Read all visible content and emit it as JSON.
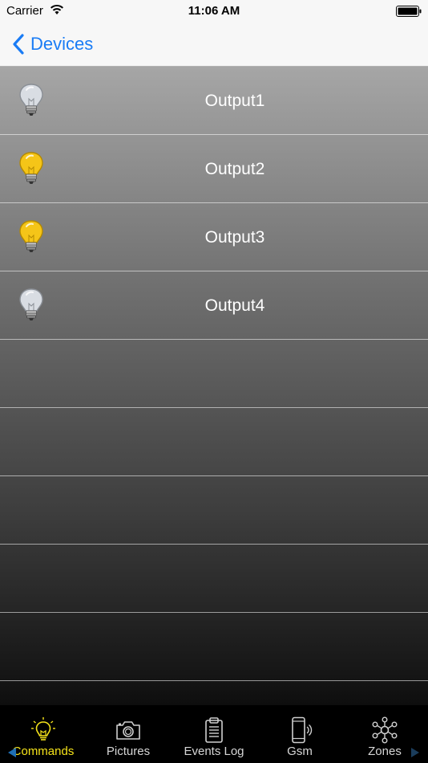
{
  "status_bar": {
    "carrier": "Carrier",
    "time": "11:06 AM"
  },
  "nav": {
    "back_label": "Devices",
    "accent_color": "#1a7cf5"
  },
  "outputs": [
    {
      "label": "Output1",
      "state": "off"
    },
    {
      "label": "Output2",
      "state": "on"
    },
    {
      "label": "Output3",
      "state": "on"
    },
    {
      "label": "Output4",
      "state": "off"
    }
  ],
  "tabs": [
    {
      "label": "Commands",
      "icon": "lightbulb-icon",
      "active": true
    },
    {
      "label": "Pictures",
      "icon": "camera-icon",
      "active": false
    },
    {
      "label": "Events Log",
      "icon": "clipboard-icon",
      "active": false
    },
    {
      "label": "Gsm",
      "icon": "phone-icon",
      "active": false
    },
    {
      "label": "Zones",
      "icon": "network-icon",
      "active": false
    }
  ],
  "colors": {
    "active_tab": "#f5e31a",
    "bulb_on": "#f5c518",
    "bulb_off": "#d9dde3"
  }
}
